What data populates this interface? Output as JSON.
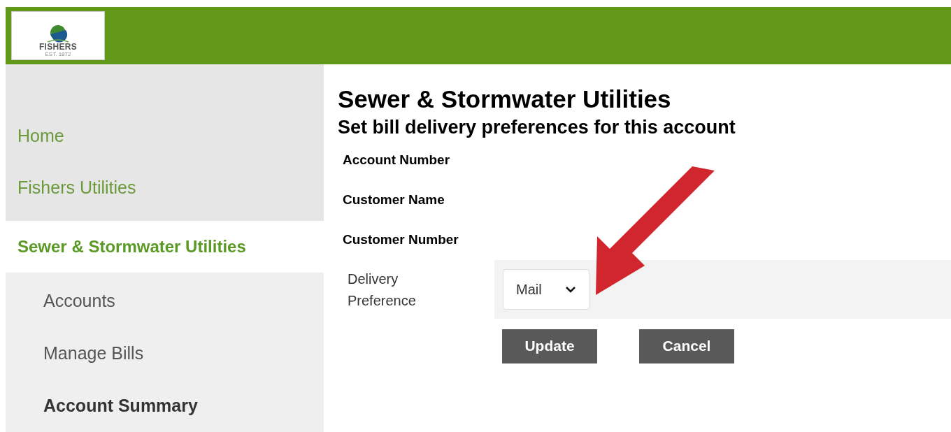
{
  "logo": {
    "name": "FISHERS",
    "tagline": "EST. 1872"
  },
  "sidebar": {
    "items": [
      {
        "label": "Home",
        "selected": false
      },
      {
        "label": "Fishers Utilities",
        "selected": false
      },
      {
        "label": "Sewer & Stormwater Utilities",
        "selected": true,
        "children": [
          {
            "label": "Accounts",
            "selected": false
          },
          {
            "label": "Manage Bills",
            "selected": false
          },
          {
            "label": "Account Summary",
            "selected": true
          }
        ]
      }
    ]
  },
  "main": {
    "title": "Sewer & Stormwater Utilities",
    "subtitle": "Set bill delivery preferences for this account",
    "fields": [
      "Account Number",
      "Customer Name",
      "Customer Number"
    ],
    "delivery": {
      "label": "Delivery Preference",
      "value": "Mail"
    },
    "buttons": [
      "Update",
      "Cancel"
    ]
  }
}
